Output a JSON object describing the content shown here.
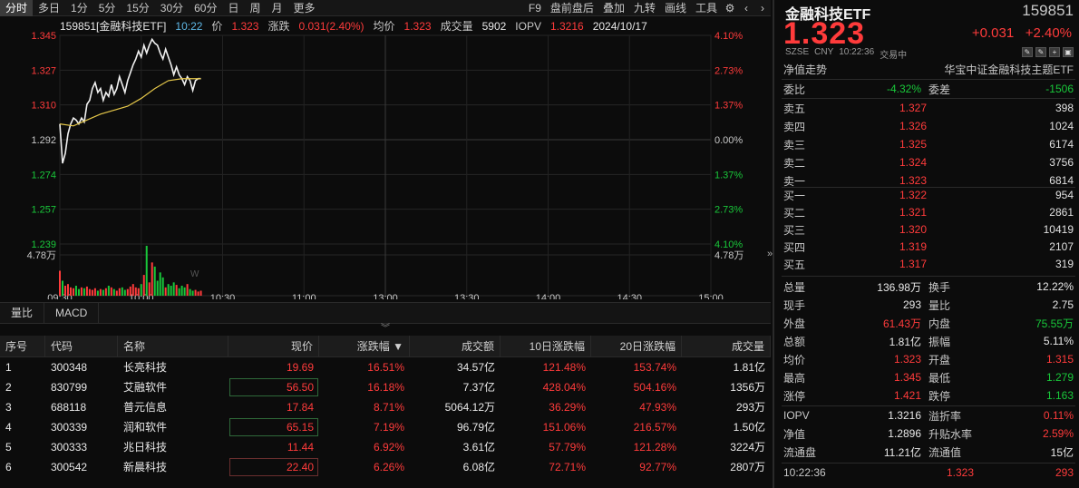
{
  "toolbar": {
    "timeframes": [
      "分时",
      "多日",
      "1分",
      "5分",
      "15分",
      "30分",
      "60分",
      "日",
      "周",
      "月",
      "更多"
    ],
    "active": "分时",
    "tools": [
      "F9",
      "盘前盘后",
      "叠加",
      "九转",
      "画线",
      "工具"
    ],
    "icons": [
      "gear-icon",
      "chevron-left-icon",
      "chevron-right-icon"
    ]
  },
  "chart": {
    "info": {
      "name": "159851[金融科技ETF]",
      "time": "10:22",
      "price_label": "价",
      "price": "1.323",
      "change_label": "涨跌",
      "change": "0.031(2.40%)",
      "avg_label": "均价",
      "avg": "1.323",
      "vol_label": "成交量",
      "vol": "5902",
      "iopv_label": "IOPV",
      "iopv": "1.3216",
      "date": "2024/10/17"
    },
    "volume_label": "4.78万",
    "watermark": "W"
  },
  "chart_data": {
    "type": "line",
    "x_ticks": [
      "09:30",
      "10:00",
      "10:30",
      "11:00",
      "13:00",
      "13:30",
      "14:00",
      "14:30",
      "15:00"
    ],
    "y_left_ticks": [
      "1.345",
      "1.327",
      "1.310",
      "1.292",
      "1.274",
      "1.257",
      "1.239"
    ],
    "y_right_ticks": [
      "4.10%",
      "2.73%",
      "1.37%",
      "0.00%",
      "1.37%",
      "2.73%",
      "4.10%"
    ],
    "ylim": [
      1.239,
      1.345
    ],
    "prev_close": 1.292,
    "series": [
      {
        "name": "价",
        "x_minutes": [
          0,
          1,
          2,
          3,
          4,
          5,
          6,
          7,
          8,
          9,
          10,
          11,
          12,
          13,
          14,
          15,
          16,
          17,
          18,
          19,
          20,
          21,
          22,
          23,
          24,
          25,
          26,
          27,
          28,
          29,
          30,
          31,
          32,
          33,
          34,
          35,
          36,
          37,
          38,
          39,
          40,
          41,
          42,
          43,
          44,
          45,
          46,
          47,
          48,
          49,
          50,
          51,
          52
        ],
        "values": [
          1.3,
          1.28,
          1.285,
          1.295,
          1.3,
          1.303,
          1.302,
          1.3,
          1.303,
          1.301,
          1.31,
          1.312,
          1.318,
          1.321,
          1.316,
          1.318,
          1.312,
          1.316,
          1.314,
          1.32,
          1.315,
          1.318,
          1.324,
          1.32,
          1.316,
          1.322,
          1.326,
          1.33,
          1.333,
          1.337,
          1.334,
          1.34,
          1.336,
          1.34,
          1.343,
          1.341,
          1.34,
          1.336,
          1.333,
          1.338,
          1.334,
          1.33,
          1.325,
          1.329,
          1.325,
          1.323,
          1.32,
          1.324,
          1.322,
          1.317,
          1.322,
          1.323,
          1.323
        ]
      },
      {
        "name": "均价",
        "x_minutes": [
          0,
          5,
          10,
          15,
          20,
          25,
          30,
          35,
          40,
          45,
          52
        ],
        "values": [
          1.3,
          1.299,
          1.302,
          1.305,
          1.307,
          1.309,
          1.313,
          1.318,
          1.322,
          1.323,
          1.323
        ]
      }
    ],
    "volume": [
      30,
      18,
      12,
      14,
      10,
      9,
      12,
      8,
      10,
      9,
      11,
      8,
      7,
      9,
      6,
      8,
      7,
      9,
      12,
      10,
      8,
      6,
      9,
      10,
      7,
      8,
      11,
      14,
      10,
      9,
      14,
      25,
      60,
      16,
      40,
      35,
      18,
      28,
      22,
      10,
      14,
      12,
      16,
      13,
      9,
      12,
      10,
      14,
      8,
      6,
      7,
      5,
      6
    ],
    "volume_colors": "mixed red/green"
  },
  "indicator_tabs": [
    "量比",
    "MACD"
  ],
  "table": {
    "headers": [
      "序号",
      "代码",
      "名称",
      "现价",
      "涨跌幅 ▼",
      "成交额",
      "10日涨跌幅",
      "20日涨跌幅",
      "成交量"
    ],
    "rows": [
      [
        "1",
        "300348",
        "长亮科技",
        "19.69",
        "16.51%",
        "34.57亿",
        "121.48%",
        "153.74%",
        "1.81亿"
      ],
      [
        "2",
        "830799",
        "艾融软件",
        "56.50",
        "16.18%",
        "7.37亿",
        "428.04%",
        "504.16%",
        "1356万"
      ],
      [
        "3",
        "688118",
        "普元信息",
        "17.84",
        "8.71%",
        "5064.12万",
        "36.29%",
        "47.93%",
        "293万"
      ],
      [
        "4",
        "300339",
        "润和软件",
        "65.15",
        "7.19%",
        "96.79亿",
        "151.06%",
        "216.57%",
        "1.50亿"
      ],
      [
        "5",
        "300333",
        "兆日科技",
        "11.44",
        "6.92%",
        "3.61亿",
        "57.79%",
        "121.28%",
        "3224万"
      ],
      [
        "6",
        "300542",
        "新晨科技",
        "22.40",
        "6.26%",
        "6.08亿",
        "72.71%",
        "92.77%",
        "2807万"
      ]
    ]
  },
  "panel": {
    "name": "金融科技ETF",
    "code": "159851",
    "price": "1.323",
    "change": "+0.031",
    "change_pct": "+2.40%",
    "market": "SZSE",
    "currency": "CNY",
    "time": "10:22:36",
    "status": "交易中",
    "net_label": "净值走势",
    "index_name": "华宝中证金融科技主题ETF",
    "weibi_label": "委比",
    "weibi": "-4.32%",
    "weicha_label": "委差",
    "weicha": "-1506",
    "asks": [
      {
        "label": "卖五",
        "price": "1.327",
        "vol": "398"
      },
      {
        "label": "卖四",
        "price": "1.326",
        "vol": "1024"
      },
      {
        "label": "卖三",
        "price": "1.325",
        "vol": "6174"
      },
      {
        "label": "卖二",
        "price": "1.324",
        "vol": "3756"
      },
      {
        "label": "卖一",
        "price": "1.323",
        "vol": "6814"
      }
    ],
    "bids": [
      {
        "label": "买一",
        "price": "1.322",
        "vol": "954"
      },
      {
        "label": "买二",
        "price": "1.321",
        "vol": "2861"
      },
      {
        "label": "买三",
        "price": "1.320",
        "vol": "10419"
      },
      {
        "label": "买四",
        "price": "1.319",
        "vol": "2107"
      },
      {
        "label": "买五",
        "price": "1.317",
        "vol": "319"
      }
    ],
    "stats": [
      {
        "a": "总量",
        "av": "136.98万",
        "ac": "white",
        "b": "换手",
        "bv": "12.22%",
        "bc": "white"
      },
      {
        "a": "现手",
        "av": "293",
        "ac": "white",
        "b": "量比",
        "bv": "2.75",
        "bc": "white"
      },
      {
        "a": "外盘",
        "av": "61.43万",
        "ac": "red",
        "b": "内盘",
        "bv": "75.55万",
        "bc": "green"
      },
      {
        "a": "总额",
        "av": "1.81亿",
        "ac": "white",
        "b": "振幅",
        "bv": "5.11%",
        "bc": "white"
      },
      {
        "a": "均价",
        "av": "1.323",
        "ac": "red",
        "b": "开盘",
        "bv": "1.315",
        "bc": "red"
      },
      {
        "a": "最高",
        "av": "1.345",
        "ac": "red",
        "b": "最低",
        "bv": "1.279",
        "bc": "green"
      },
      {
        "a": "涨停",
        "av": "1.421",
        "ac": "red",
        "b": "跌停",
        "bv": "1.163",
        "bc": "green"
      }
    ],
    "stats2": [
      {
        "a": "IOPV",
        "av": "1.3216",
        "ac": "white",
        "b": "溢折率",
        "bv": "0.11%",
        "bc": "red"
      },
      {
        "a": "净值",
        "av": "1.2896",
        "ac": "white",
        "b": "升贴水率",
        "bv": "2.59%",
        "bc": "red"
      },
      {
        "a": "流通盘",
        "av": "11.21亿",
        "ac": "white",
        "b": "流通值",
        "bv": "15亿",
        "bc": "white"
      }
    ],
    "tick": {
      "time": "10:22:36",
      "price": "1.323",
      "vol": "293"
    }
  }
}
